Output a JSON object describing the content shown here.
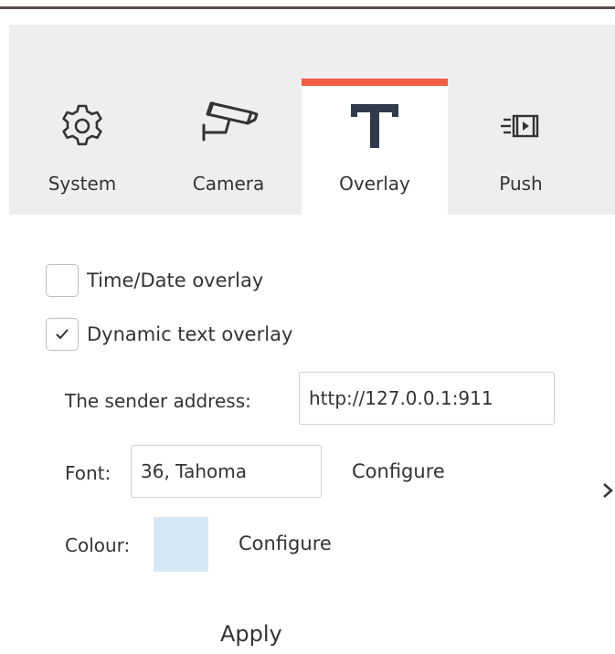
{
  "tabs": [
    {
      "label": "System",
      "icon": "gear-icon"
    },
    {
      "label": "Camera",
      "icon": "security-camera-icon"
    },
    {
      "label": "Overlay",
      "icon": "text-t-icon",
      "active": true
    },
    {
      "label": "Push",
      "icon": "push-video-icon"
    }
  ],
  "accent_color": "#f25c42",
  "overlay": {
    "time_date_label": "Time/Date overlay",
    "time_date_checked": false,
    "dynamic_text_label": "Dynamic text overlay",
    "dynamic_text_checked": true,
    "sender_address_label": "The sender address:",
    "sender_address_value": "http://127.0.0.1:911",
    "font_label": "Font:",
    "font_value": "36, Tahoma",
    "font_configure": "Configure",
    "colour_label": "Colour:",
    "colour_value": "#d6e8f7",
    "colour_configure": "Configure",
    "apply_label": "Apply"
  },
  "side_arrow": "chevron-right-icon"
}
